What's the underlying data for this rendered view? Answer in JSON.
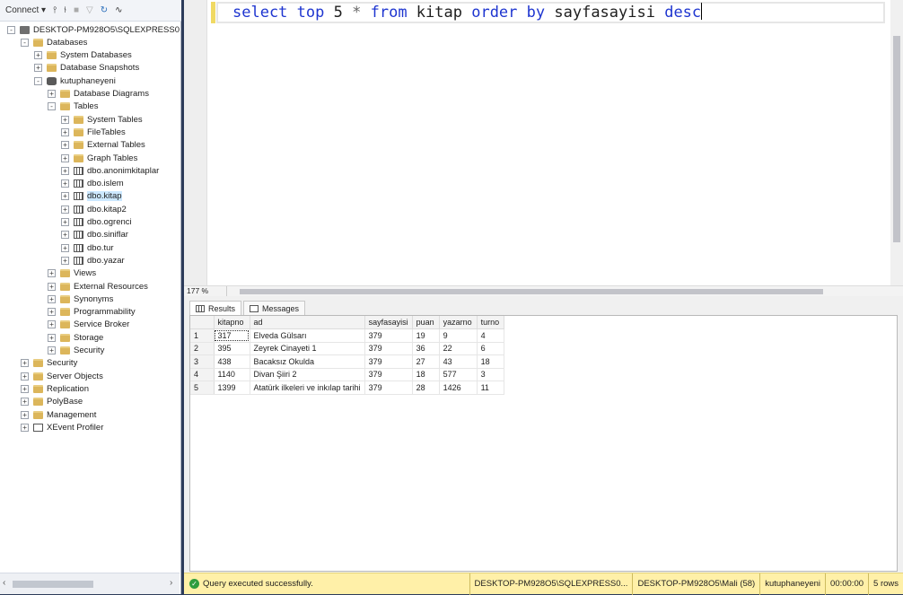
{
  "object_explorer": {
    "toolbar": {
      "connect_label": "Connect ▾",
      "icons": [
        "plug-icon",
        "unplug-icon",
        "stop-icon",
        "filter-icon",
        "refresh-icon",
        "activity-icon"
      ]
    },
    "tree": [
      {
        "label": "DESKTOP-PM928O5\\SQLEXPRESS01 (SQ",
        "level": 0,
        "icon": "server-icon",
        "expander": "-"
      },
      {
        "label": "Databases",
        "level": 1,
        "icon": "folder-icon",
        "expander": "-"
      },
      {
        "label": "System Databases",
        "level": 2,
        "icon": "folder-icon",
        "expander": "+"
      },
      {
        "label": "Database Snapshots",
        "level": 2,
        "icon": "folder-icon",
        "expander": "+"
      },
      {
        "label": "kutuphaneyeni",
        "level": 2,
        "icon": "database-icon",
        "expander": "-"
      },
      {
        "label": "Database Diagrams",
        "level": 3,
        "icon": "folder-icon",
        "expander": "+"
      },
      {
        "label": "Tables",
        "level": 3,
        "icon": "folder-icon",
        "expander": "-"
      },
      {
        "label": "System Tables",
        "level": 4,
        "icon": "folder-icon",
        "expander": "+"
      },
      {
        "label": "FileTables",
        "level": 4,
        "icon": "folder-icon",
        "expander": "+"
      },
      {
        "label": "External Tables",
        "level": 4,
        "icon": "folder-icon",
        "expander": "+"
      },
      {
        "label": "Graph Tables",
        "level": 4,
        "icon": "folder-icon",
        "expander": "+"
      },
      {
        "label": "dbo.anonimkitaplar",
        "level": 4,
        "icon": "table-icon",
        "expander": "+"
      },
      {
        "label": "dbo.islem",
        "level": 4,
        "icon": "table-icon",
        "expander": "+"
      },
      {
        "label": "dbo.kitap",
        "level": 4,
        "icon": "table-icon",
        "expander": "+",
        "selected": true
      },
      {
        "label": "dbo.kitap2",
        "level": 4,
        "icon": "table-icon",
        "expander": "+"
      },
      {
        "label": "dbo.ogrenci",
        "level": 4,
        "icon": "table-icon",
        "expander": "+"
      },
      {
        "label": "dbo.siniflar",
        "level": 4,
        "icon": "table-icon",
        "expander": "+"
      },
      {
        "label": "dbo.tur",
        "level": 4,
        "icon": "table-icon",
        "expander": "+"
      },
      {
        "label": "dbo.yazar",
        "level": 4,
        "icon": "table-icon",
        "expander": "+"
      },
      {
        "label": "Views",
        "level": 3,
        "icon": "folder-icon",
        "expander": "+"
      },
      {
        "label": "External Resources",
        "level": 3,
        "icon": "folder-icon",
        "expander": "+"
      },
      {
        "label": "Synonyms",
        "level": 3,
        "icon": "folder-icon",
        "expander": "+"
      },
      {
        "label": "Programmability",
        "level": 3,
        "icon": "folder-icon",
        "expander": "+"
      },
      {
        "label": "Service Broker",
        "level": 3,
        "icon": "folder-icon",
        "expander": "+"
      },
      {
        "label": "Storage",
        "level": 3,
        "icon": "folder-icon",
        "expander": "+"
      },
      {
        "label": "Security",
        "level": 3,
        "icon": "folder-icon",
        "expander": "+"
      },
      {
        "label": "Security",
        "level": 1,
        "icon": "folder-icon",
        "expander": "+"
      },
      {
        "label": "Server Objects",
        "level": 1,
        "icon": "folder-icon",
        "expander": "+"
      },
      {
        "label": "Replication",
        "level": 1,
        "icon": "folder-icon",
        "expander": "+"
      },
      {
        "label": "PolyBase",
        "level": 1,
        "icon": "folder-icon",
        "expander": "+"
      },
      {
        "label": "Management",
        "level": 1,
        "icon": "folder-icon",
        "expander": "+"
      },
      {
        "label": "XEvent Profiler",
        "level": 1,
        "icon": "xevent-icon",
        "expander": "+"
      }
    ]
  },
  "editor": {
    "query_tokens": [
      {
        "t": "select",
        "kw": true
      },
      {
        "t": " "
      },
      {
        "t": "top",
        "kw": true
      },
      {
        "t": " 5 "
      },
      {
        "t": "*",
        "op": true
      },
      {
        "t": " "
      },
      {
        "t": "from",
        "kw": true
      },
      {
        "t": " kitap "
      },
      {
        "t": "order",
        "kw": true
      },
      {
        "t": " "
      },
      {
        "t": "by",
        "kw": true
      },
      {
        "t": " sayfasayisi "
      },
      {
        "t": "desc",
        "kw": true
      }
    ],
    "zoom": "177 %"
  },
  "results": {
    "tabs": [
      {
        "label": "Results",
        "active": true
      },
      {
        "label": "Messages",
        "active": false
      }
    ],
    "columns": [
      "kitapno",
      "ad",
      "sayfasayisi",
      "puan",
      "yazarno",
      "turno"
    ],
    "rows": [
      [
        "1",
        "317",
        "Elveda Gülsarı",
        "379",
        "19",
        "9",
        "4"
      ],
      [
        "2",
        "395",
        "Zeyrek Cinayeti 1",
        "379",
        "36",
        "22",
        "6"
      ],
      [
        "3",
        "438",
        "Bacaksız Okulda",
        "379",
        "27",
        "43",
        "18"
      ],
      [
        "4",
        "1140",
        "Divan Şiiri 2",
        "379",
        "18",
        "577",
        "3"
      ],
      [
        "5",
        "1399",
        "Atatürk ilkeleri ve inkılap tarihi",
        "379",
        "28",
        "1426",
        "11"
      ]
    ]
  },
  "status": {
    "message": "Query executed successfully.",
    "server": "DESKTOP-PM928O5\\SQLEXPRESS0...",
    "user": "DESKTOP-PM928O5\\Mali (58)",
    "database": "kutuphaneyeni",
    "time": "00:00:00",
    "rows": "5 rows"
  }
}
